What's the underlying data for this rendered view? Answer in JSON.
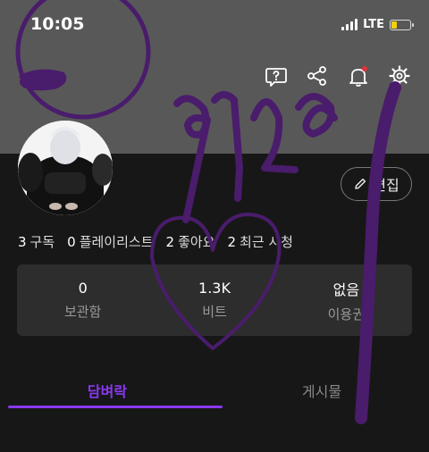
{
  "status_bar": {
    "time": "10:05",
    "network": "LTE",
    "battery_level": 0.3
  },
  "toolbar": {
    "icons": [
      "help-icon",
      "share-icon",
      "notification-bell-icon",
      "settings-gear-icon"
    ]
  },
  "profile": {
    "edit_label": "편집"
  },
  "stats": [
    {
      "count": "3",
      "label": "구독"
    },
    {
      "count": "0",
      "label": "플레이리스트"
    },
    {
      "count": "2",
      "label": "좋아요"
    },
    {
      "count": "2",
      "label": "최근 시청"
    }
  ],
  "summary": [
    {
      "value": "0",
      "label": "보관함"
    },
    {
      "value": "1.3K",
      "label": "비트"
    },
    {
      "value": "없음",
      "label": "이용권"
    }
  ],
  "tabs": [
    {
      "label": "담벼락",
      "active": true
    },
    {
      "label": "게시물",
      "active": false
    }
  ],
  "colors": {
    "accent": "#8a38ef",
    "header": "#585858",
    "background": "#171717",
    "card": "#2d2d2d",
    "drawing": "#4a1c6c",
    "badge": "#e0323c"
  }
}
